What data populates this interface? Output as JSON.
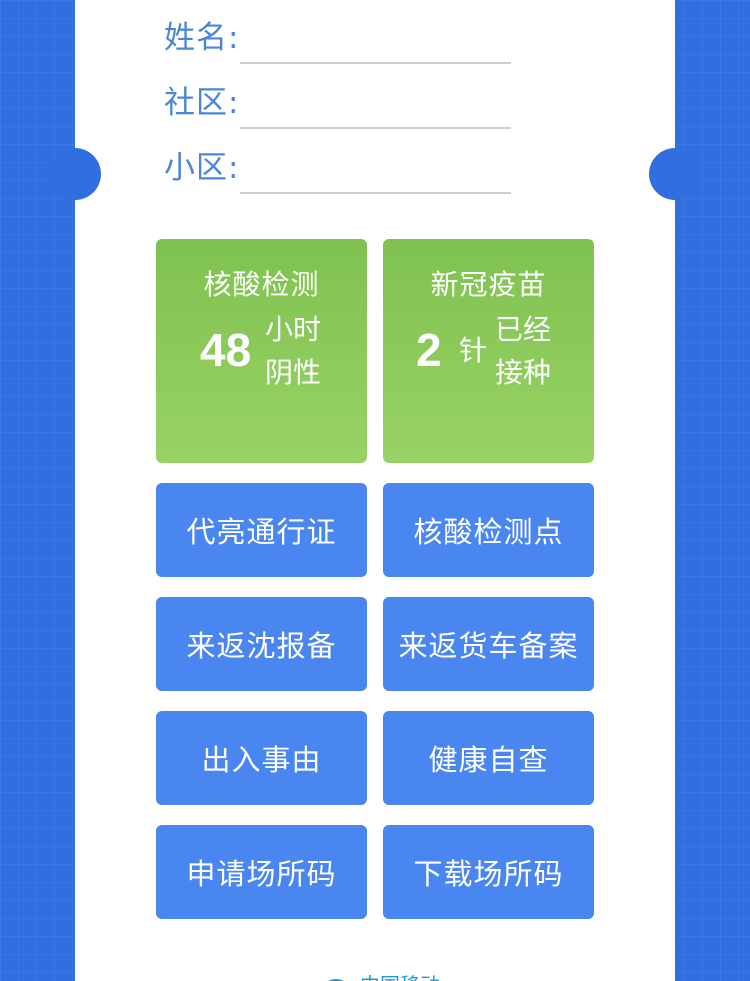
{
  "form": {
    "name_label": "姓名:",
    "community_label": "社区:",
    "compound_label": "小区:"
  },
  "status": {
    "nucleic": {
      "title": "核酸检测",
      "value": "48",
      "unit": "小时",
      "result": "阴性"
    },
    "vaccine": {
      "title": "新冠疫苗",
      "value": "2",
      "unit": "针",
      "result_line1": "已经",
      "result_line2": "接种"
    },
    "card_color": "#8ccb5b"
  },
  "buttons": [
    {
      "label": "代亮通行证"
    },
    {
      "label": "核酸检测点"
    },
    {
      "label": "来返沈报备"
    },
    {
      "label": "来返货车备案"
    },
    {
      "label": "出入事由"
    },
    {
      "label": "健康自查"
    },
    {
      "label": "申请场所码"
    },
    {
      "label": "下载场所码"
    }
  ],
  "footer": {
    "brand": "中国移动",
    "icon": "china-mobile-logo-icon"
  },
  "colors": {
    "background": "#2f6fe0",
    "button": "#4a86f0",
    "label": "#4a86d8"
  }
}
